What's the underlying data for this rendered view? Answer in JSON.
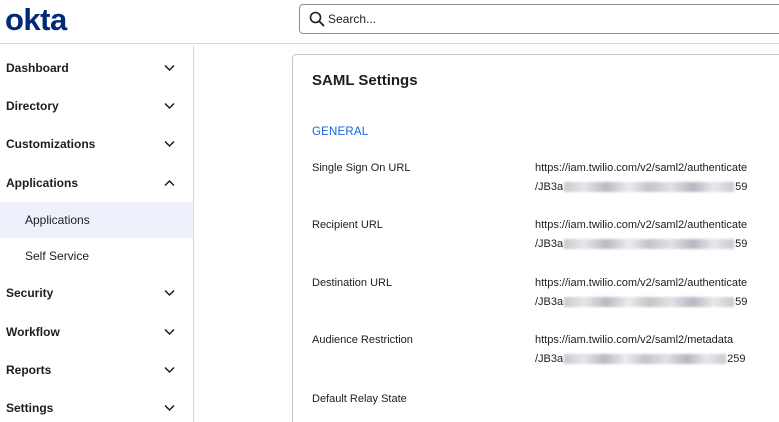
{
  "header": {
    "logo_text": "okta",
    "search_placeholder": "Search..."
  },
  "sidebar": {
    "items": [
      {
        "label": "Dashboard"
      },
      {
        "label": "Directory"
      },
      {
        "label": "Customizations"
      },
      {
        "label": "Applications",
        "expanded": true
      },
      {
        "label": "Security"
      },
      {
        "label": "Workflow"
      },
      {
        "label": "Reports"
      },
      {
        "label": "Settings"
      }
    ],
    "sub_items": [
      {
        "label": "Applications",
        "active": true
      },
      {
        "label": "Self Service"
      }
    ]
  },
  "card": {
    "title": "SAML Settings",
    "section": "GENERAL",
    "rows": [
      {
        "label": "Single Sign On URL",
        "value_line1": "https://iam.twilio.com/v2/saml2/authenticate",
        "value_prefix": "/JB3a",
        "value_suffix": "59"
      },
      {
        "label": "Recipient URL",
        "value_line1": "https://iam.twilio.com/v2/saml2/authenticate",
        "value_prefix": "/JB3a",
        "value_suffix": "59"
      },
      {
        "label": "Destination URL",
        "value_line1": "https://iam.twilio.com/v2/saml2/authenticate",
        "value_prefix": "/JB3a",
        "value_suffix": "59"
      },
      {
        "label": "Audience Restriction",
        "value_line1": "https://iam.twilio.com/v2/saml2/metadata",
        "value_prefix": "/JB3a",
        "value_suffix": "259"
      },
      {
        "label": "Default Relay State"
      }
    ]
  },
  "colors": {
    "brand": "#00297a",
    "section_link": "#1662dd",
    "active_nav_bg": "#eef1fb"
  },
  "icons": [
    "search-icon",
    "chevron-down-icon",
    "chevron-up-icon"
  ]
}
